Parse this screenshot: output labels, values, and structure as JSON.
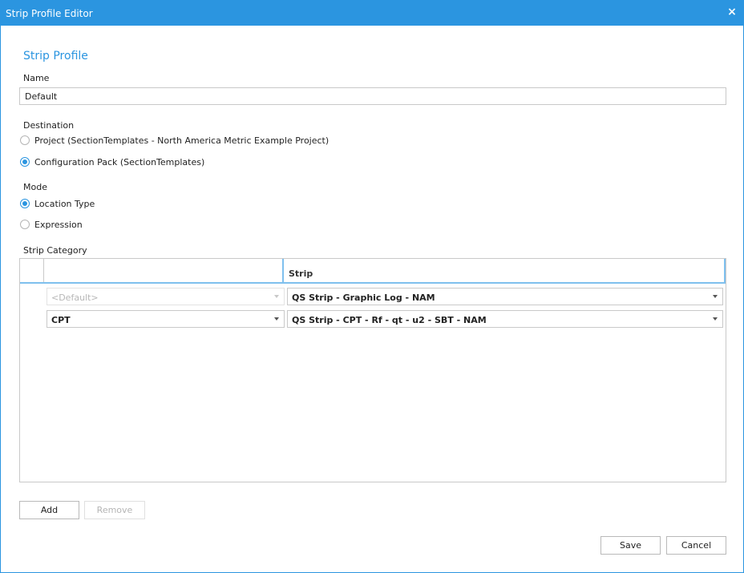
{
  "window": {
    "title": "Strip Profile Editor",
    "close_icon": "×"
  },
  "section_title": "Strip Profile",
  "name": {
    "label": "Name",
    "value": "Default"
  },
  "destination": {
    "label": "Destination",
    "options": [
      {
        "label": "Project (SectionTemplates - North America Metric Example Project)",
        "checked": false
      },
      {
        "label": "Configuration Pack (SectionTemplates)",
        "checked": true
      }
    ]
  },
  "mode": {
    "label": "Mode",
    "options": [
      {
        "label": "Location Type",
        "checked": true
      },
      {
        "label": "Expression",
        "checked": false
      }
    ]
  },
  "strip_category": {
    "label": "Strip Category",
    "columns": [
      "",
      "",
      "Strip"
    ],
    "rows": [
      {
        "category": "<Default>",
        "category_disabled": true,
        "strip": "QS Strip - Graphic Log - NAM"
      },
      {
        "category": "CPT",
        "category_disabled": false,
        "strip": "QS Strip - CPT - Rf - qt - u2 - SBT - NAM"
      }
    ]
  },
  "buttons": {
    "add": "Add",
    "remove": "Remove",
    "save": "Save",
    "cancel": "Cancel"
  },
  "colors": {
    "accent": "#2b95e0",
    "header_underline": "#7fc0ee"
  }
}
